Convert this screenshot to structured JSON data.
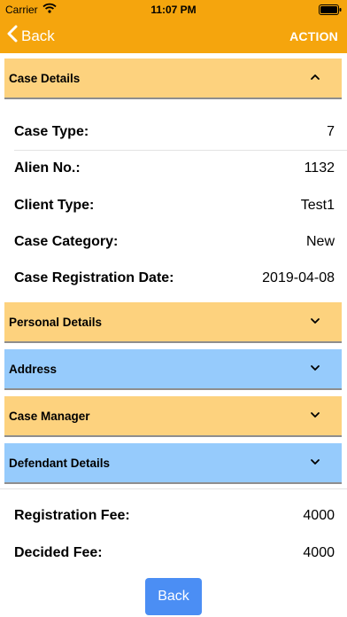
{
  "status_bar": {
    "carrier": "Carrier",
    "time": "11:07 PM"
  },
  "nav": {
    "back_label": "Back",
    "action_label": "ACTION"
  },
  "sections": {
    "case_details": "Case Details",
    "personal_details": "Personal Details",
    "address": "Address",
    "case_manager": "Case Manager",
    "defendant_details": "Defendant Details"
  },
  "case_details": {
    "case_type": {
      "label": "Case Type:",
      "value": "7"
    },
    "alien_no": {
      "label": "Alien No.:",
      "value": "1132"
    },
    "client_type": {
      "label": "Client Type:",
      "value": "Test1"
    },
    "case_category": {
      "label": "Case Category:",
      "value": "New"
    },
    "registration_date": {
      "label": "Case Registration Date:",
      "value": "2019-04-08"
    }
  },
  "fees": {
    "registration_fee": {
      "label": "Registration Fee:",
      "value": "4000"
    },
    "decided_fee": {
      "label": "Decided Fee:",
      "value": "4000"
    }
  },
  "footer": {
    "back_button": "Back"
  },
  "colors": {
    "accent": "#f5a50d",
    "orange_header": "#fdd27e",
    "blue_header": "#96cbfc",
    "button": "#4b8ef4"
  },
  "icons": {
    "wifi": "wifi-icon",
    "battery": "battery-icon",
    "back": "chevron-left-icon",
    "expanded": "chevron-up-icon",
    "collapsed": "chevron-down-icon"
  }
}
